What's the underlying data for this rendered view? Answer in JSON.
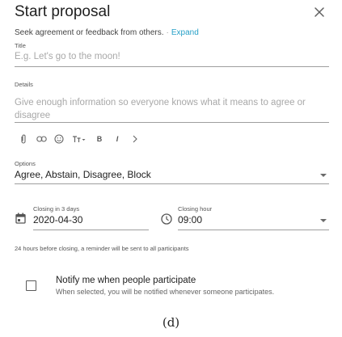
{
  "dialog": {
    "title": "Start proposal",
    "close_icon": "close-icon",
    "subtitle": "Seek agreement or feedback from others.",
    "separator": "·",
    "expand_label": "Expand"
  },
  "title_field": {
    "label": "Title",
    "placeholder": "E.g. Let's go to the moon!",
    "value": ""
  },
  "details_field": {
    "label": "Details",
    "placeholder": "Give enough information so everyone knows what it means to agree or disagree",
    "value": ""
  },
  "toolbar": {
    "icons": [
      "attachment-icon",
      "link-icon",
      "emoji-icon",
      "text-size-icon",
      "bold-icon",
      "italic-icon",
      "chevron-right-icon"
    ],
    "bold_label": "B",
    "italic_label": "I"
  },
  "options_field": {
    "label": "Options",
    "value": "Agree, Abstain, Disagree, Block"
  },
  "closing_date": {
    "label": "Closing in 3 days",
    "value": "2020-04-30",
    "icon": "calendar-icon"
  },
  "closing_hour": {
    "label": "Closing hour",
    "value": "09:00",
    "icon": "clock-icon"
  },
  "reminder_text": "24 hours before closing, a reminder will be sent to all participants",
  "notify": {
    "checked": false,
    "title": "Notify me when people participate",
    "description": "When selected, you will be notified whenever someone participates."
  },
  "caption": "(d)"
}
